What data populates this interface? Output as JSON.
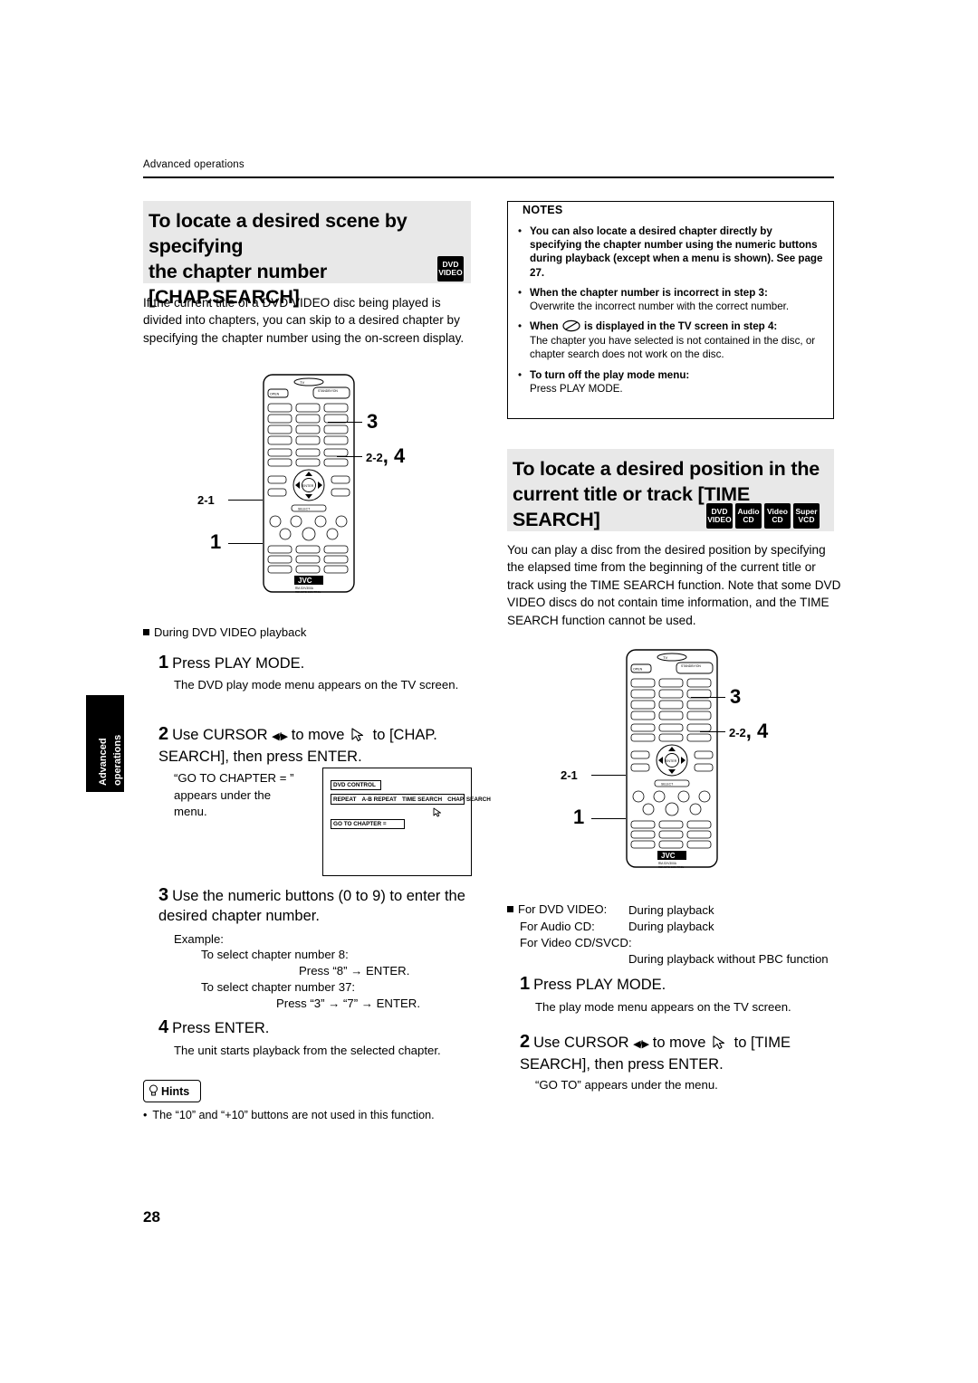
{
  "header": {
    "section": "Advanced operations",
    "side_tab_line1": "Advanced",
    "side_tab_line2": "operations"
  },
  "page_number": "28",
  "left_column": {
    "banner_title_line1": "To locate a desired scene by specifying",
    "banner_title_line2": "the chapter number [CHAP.SEARCH]",
    "disc_logos": [
      {
        "line1": "DVD",
        "line2": "VIDEO"
      }
    ],
    "intro": "If the current title of a DVD VIDEO disc being played is divided into chapters, you can skip to a desired chapter by specifying the chapter number using the on-screen display.",
    "remote_callouts": {
      "c3": "3",
      "c2_2_4": "2-2, 4",
      "c2_1": "2-1",
      "c1": "1"
    },
    "playback_note": "During DVD VIDEO playback",
    "steps": [
      {
        "num": "1",
        "text": "Press PLAY MODE.",
        "detail": "The DVD play mode menu appears on the TV screen."
      },
      {
        "num": "2",
        "text_before": "Use CURSOR",
        "cursor": "◀/▶",
        "text_mid": "to move",
        "text_after": "to [CHAP.",
        "text_line2": "SEARCH], then press ENTER.",
        "detail_line1": "“GO TO CHAPTER = ”",
        "detail_line2": "appears under the",
        "detail_line3": "menu."
      },
      {
        "num": "3",
        "text_line1": "Use the numeric buttons (0 to 9) to enter the",
        "text_line2": "desired chapter number.",
        "example_label": "Example:",
        "example_lines": [
          "To select chapter number 8:",
          "Press “8” → ENTER.",
          "To select chapter number 37:",
          "Press “3” → “7” → ENTER."
        ]
      },
      {
        "num": "4",
        "text": "Press ENTER.",
        "detail": "The unit starts playback from the selected chapter."
      }
    ],
    "tv_diagram": {
      "title": "DVD CONTROL",
      "menu_items": [
        "REPEAT",
        "A-B REPEAT",
        "TIME SEARCH",
        "CHAP. SEARCH"
      ],
      "status": "GO TO CHAPTER ="
    },
    "hints": {
      "label": "Hints",
      "text": "The “10” and “+10” buttons are not used in this function."
    }
  },
  "right_column": {
    "notes": {
      "title": "NOTES",
      "items": [
        {
          "bold": "You can also locate a desired chapter directly by specifying the chapter number using the numeric buttons during playback (except when a menu is shown). See page 27.",
          "plain": ""
        },
        {
          "bold": "When the chapter number is incorrect in step 3:",
          "plain": "Overwrite the incorrect number with the correct number."
        },
        {
          "bold_a": "When",
          "bold_b": "is displayed in the TV screen in step 4:",
          "plain": "The chapter you have selected is not contained in the disc, or chapter search does not work on the disc."
        },
        {
          "bold": "To turn off the play mode menu:",
          "plain": "Press PLAY MODE."
        }
      ]
    },
    "banner_title_line1": "To locate a desired position in the",
    "banner_title_line2": "current title or track [TIME SEARCH]",
    "disc_logos": [
      {
        "line1": "DVD",
        "line2": "VIDEO"
      },
      {
        "line1": "Audio",
        "line2": "CD"
      },
      {
        "line1": "Video",
        "line2": "CD"
      },
      {
        "line1": "Super",
        "line2": "VCD"
      }
    ],
    "intro": "You can play a disc from the desired position by specifying the elapsed time from the beginning of the current title or track using the TIME SEARCH function. Note that some DVD VIDEO discs do not contain time information, and the TIME SEARCH function cannot be used.",
    "remote_callouts": {
      "c3": "3",
      "c2_2_4": "2-2, 4",
      "c2_1": "2-1",
      "c1": "1"
    },
    "availability": [
      {
        "label": "For DVD VIDEO:",
        "value": "During playback"
      },
      {
        "label": "For Audio CD:",
        "value": "During playback"
      },
      {
        "label": "For Video CD/SVCD:",
        "value": ""
      },
      {
        "label": "",
        "value": "During playback without PBC function"
      }
    ],
    "steps": [
      {
        "num": "1",
        "text": "Press PLAY MODE.",
        "detail": "The play mode menu appears on the TV screen."
      },
      {
        "num": "2",
        "text_before": "Use CURSOR",
        "cursor": "◀/▶",
        "text_mid": "to move",
        "text_after": "to [TIME",
        "text_line2": "SEARCH],  then press ENTER.",
        "detail": "“GO TO” appears under the menu."
      }
    ]
  },
  "remote": {
    "brand": "JVC",
    "model_line1": "RM-SXV300A",
    "model_line2": "REMOTE CONTROL",
    "top_label": "TV",
    "buttons": {
      "open": "OPEN",
      "standby": "STANDBY/ON"
    }
  }
}
